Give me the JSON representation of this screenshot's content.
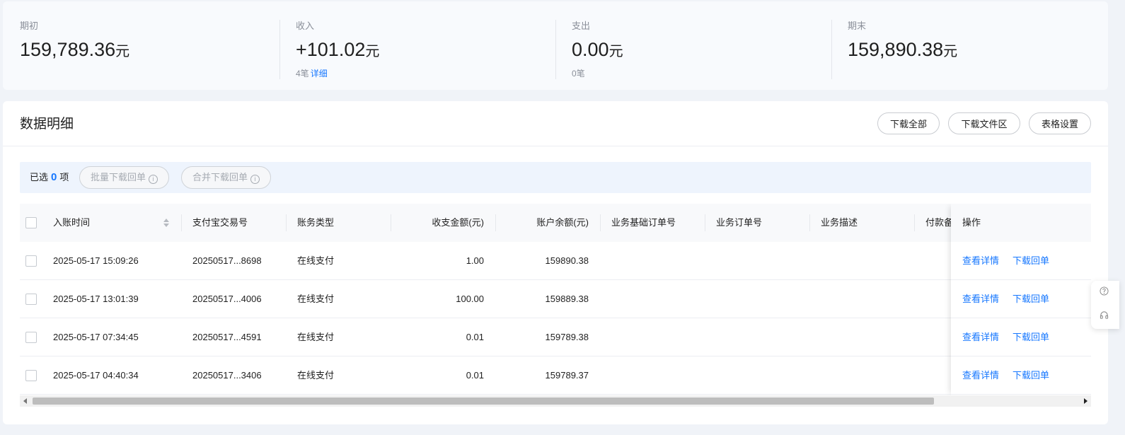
{
  "summary": {
    "opening": {
      "label": "期初",
      "amount": "159,789.36",
      "unit": "元"
    },
    "income": {
      "label": "收入",
      "amount": "+101.02",
      "unit": "元",
      "count": "4笔",
      "detail_link": "详细"
    },
    "expense": {
      "label": "支出",
      "amount": "0.00",
      "unit": "元",
      "count": "0笔"
    },
    "closing": {
      "label": "期末",
      "amount": "159,890.38",
      "unit": "元"
    }
  },
  "detail": {
    "title": "数据明细",
    "buttons": {
      "download_all": "下载全部",
      "download_area": "下载文件区",
      "table_settings": "表格设置"
    }
  },
  "selection": {
    "prefix": "已选",
    "count": "0",
    "suffix": "项",
    "batch_download": "批量下载回单",
    "merge_download": "合并下载回单"
  },
  "table": {
    "columns": {
      "time": "入账时间",
      "trade_no": "支付宝交易号",
      "type": "账务类型",
      "amount": "收支金额(元)",
      "balance": "账户余额(元)",
      "base_order": "业务基础订单号",
      "order": "业务订单号",
      "desc": "业务描述",
      "payer": "付款备",
      "ops": "操作"
    },
    "rows": [
      {
        "time": "2025-05-17 15:09:26",
        "trade_no": "20250517...8698",
        "type": "在线支付",
        "amount": "1.00",
        "balance": "159890.38"
      },
      {
        "time": "2025-05-17 13:01:39",
        "trade_no": "20250517...4006",
        "type": "在线支付",
        "amount": "100.00",
        "balance": "159889.38"
      },
      {
        "time": "2025-05-17 07:34:45",
        "trade_no": "20250517...4591",
        "type": "在线支付",
        "amount": "0.01",
        "balance": "159789.38"
      },
      {
        "time": "2025-05-17 04:40:34",
        "trade_no": "20250517...3406",
        "type": "在线支付",
        "amount": "0.01",
        "balance": "159789.37"
      }
    ],
    "actions": {
      "view": "查看详情",
      "download": "下载回单"
    }
  },
  "colors": {
    "accent": "#1677ff",
    "selection_bg": "#eef4fd"
  },
  "icons": {
    "sort": "sort-icon",
    "info": "info-icon",
    "help": "question-icon",
    "support": "headset-icon"
  }
}
